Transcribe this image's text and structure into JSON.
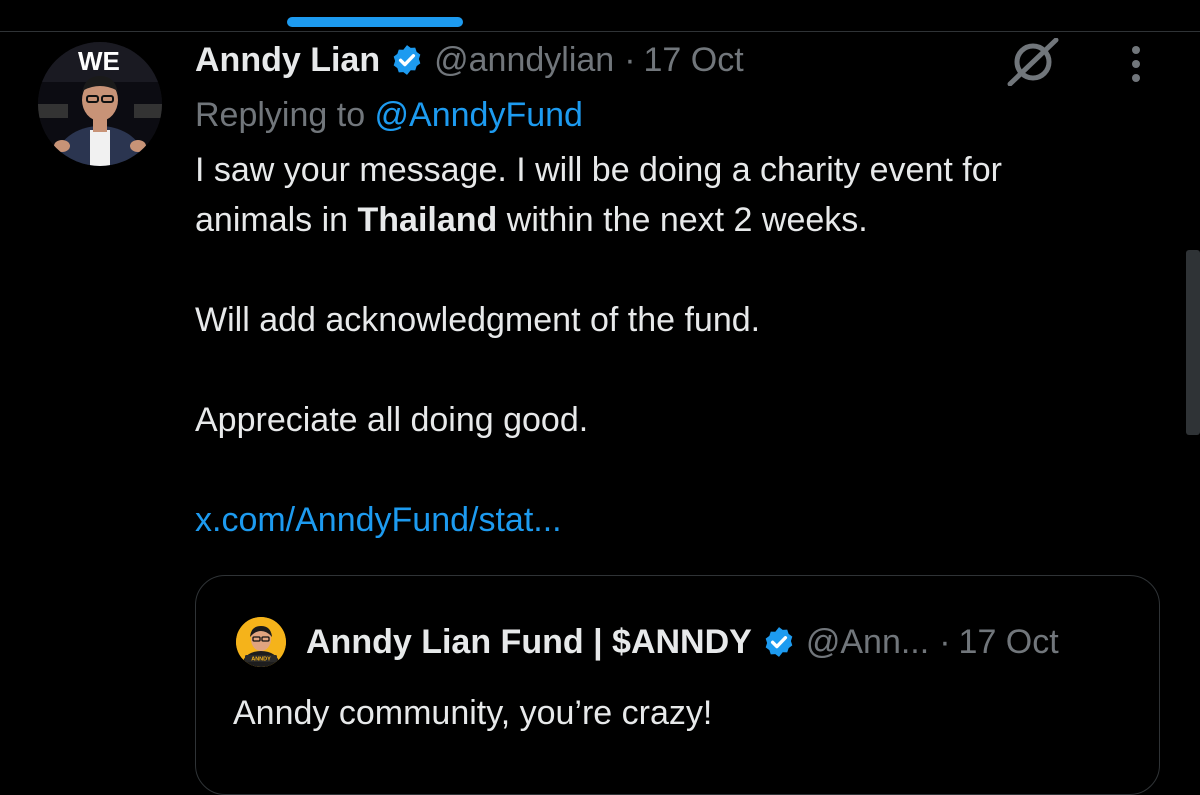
{
  "tweet": {
    "author": {
      "display_name": "Anndy Lian",
      "handle": "@anndylian",
      "date": "17 Oct",
      "verified": true,
      "avatar_icon": "user-avatar-presenter"
    },
    "separator": "·",
    "replying_prefix": "Replying to ",
    "replying_handle": "@AnndyFund",
    "text": {
      "line1": "I saw your message. I will be doing a charity event for",
      "line2_before": "animals in ",
      "line2_bold": "Thailand",
      "line2_after": " within the next 2 weeks.",
      "paragraph2": "Will add acknowledgment of the fund.",
      "paragraph3": "Appreciate all doing good."
    },
    "link": "x.com/AnndyFund/stat...",
    "actions": {
      "grok_icon": "grok-icon",
      "more_icon": "more-vertical-icon"
    }
  },
  "quote": {
    "display_name": "Anndy Lian Fund | $ANNDY",
    "handle": "@Ann...",
    "separator": "·",
    "date": "17 Oct",
    "verified": true,
    "text": "Anndy community, you’re crazy!",
    "avatar_label": "ANNDY"
  },
  "colors": {
    "background": "#000000",
    "text": "#e7e9ea",
    "muted": "#71767b",
    "accent": "#1d9bf0",
    "border": "#2f3336"
  }
}
